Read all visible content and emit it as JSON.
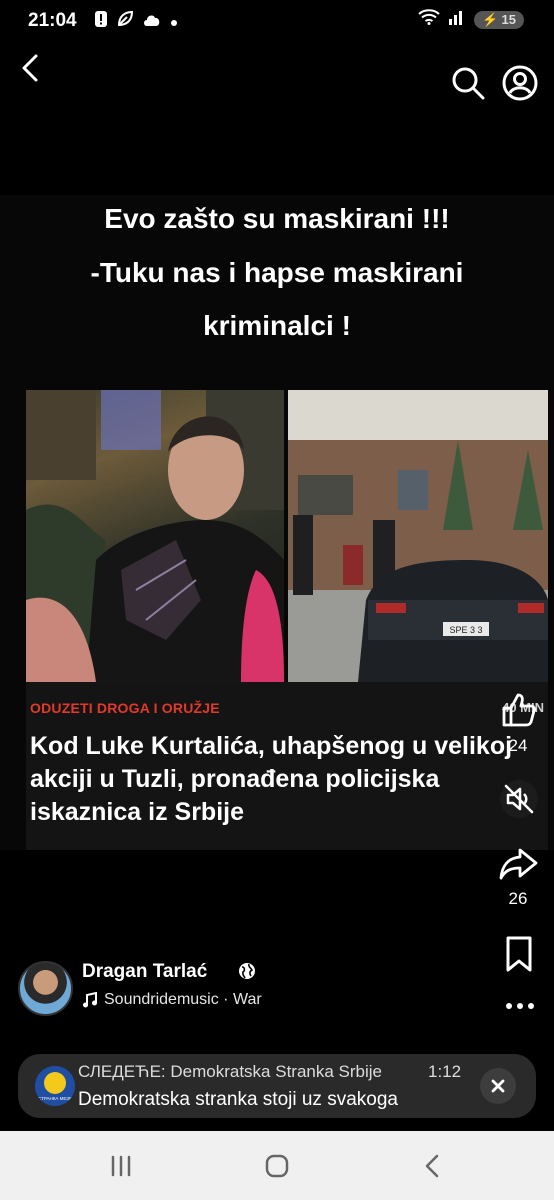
{
  "status_bar": {
    "time": "21:04",
    "left_icons": [
      "alert-icon",
      "leaf-icon",
      "cloud-icon",
      "dot-icon"
    ],
    "battery_level": "15"
  },
  "nav": {
    "back_icon": "chevron-left-icon",
    "search_icon": "search-icon",
    "profile_icon": "profile-icon"
  },
  "post": {
    "meme_lines": [
      "Evo zašto su maskirani !!!",
      "-Tuku nas i hapse maskirani",
      "kriminalci !"
    ],
    "news_tag": "ODUZETI DROGA I ORUŽJE",
    "news_time": "40 MIN",
    "news_headline": "Kod Luke Kurtalića, uhapšenog u velikoj akciji u Tuzli, pronađena policijska iskaznica iz Srbije",
    "plate_text": "SPE 3 3"
  },
  "actions": {
    "likes": "24",
    "shares": "26"
  },
  "author": {
    "name": "Dragan Tarlać",
    "audio": "Soundridemusic · War"
  },
  "next_up": {
    "label": "СЛЕДЕЋЕ: Demokratska Stranka Srbije",
    "duration": "1:12",
    "title": "Demokratska stranka stoji uz svakoga",
    "thumb_text": "СТРАНКА МЕЗЕ"
  },
  "colors": {
    "background": "#000000",
    "news_tag": "#e2392b",
    "banner": "#2a2a2a",
    "system_nav": "#f0f0f0"
  }
}
